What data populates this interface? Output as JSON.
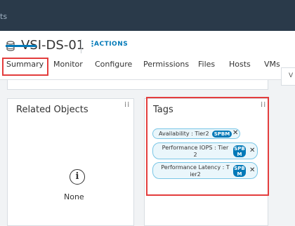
{
  "topbar": {
    "title_fragment": "ts"
  },
  "header": {
    "title": "VSI-DS-01",
    "actions_label": "ACTIONS"
  },
  "tabs": [
    {
      "label": "Summary",
      "active": true
    },
    {
      "label": "Monitor"
    },
    {
      "label": "Configure"
    },
    {
      "label": "Permissions"
    },
    {
      "label": "Files"
    },
    {
      "label": "Hosts"
    },
    {
      "label": "VMs"
    }
  ],
  "right_fragment": "V",
  "related_objects": {
    "title": "Related Objects",
    "empty_text": "None"
  },
  "tags_card": {
    "title": "Tags",
    "items": [
      {
        "text": "Availability : Tier2",
        "badge": "SPBM"
      },
      {
        "text_line1": "Performance IOPS : Tier",
        "text_line2": "2",
        "badge_line1": "SPB",
        "badge_line2": "M"
      },
      {
        "text_line1": "Performance Latency : T",
        "text_line2": "ier2",
        "badge_line1": "SPB",
        "badge_line2": "M"
      }
    ]
  },
  "colors": {
    "accent": "#0079b8",
    "highlight": "#e33d3d",
    "topbar": "#2a3a4a"
  }
}
